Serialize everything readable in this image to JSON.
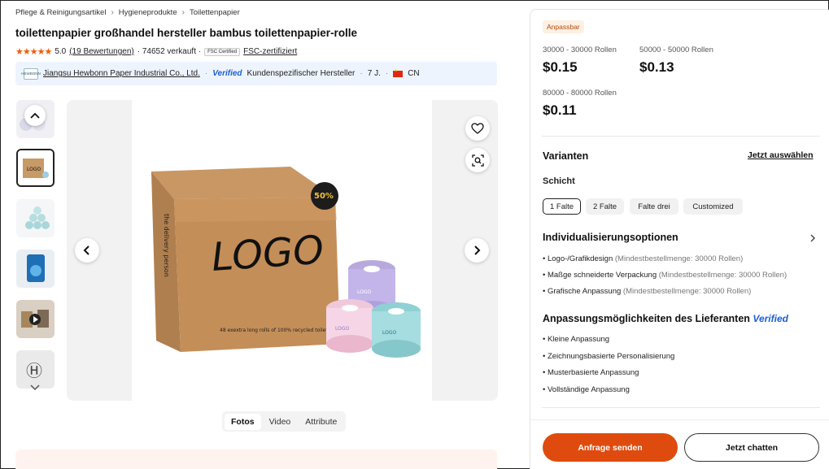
{
  "breadcrumb": [
    "Pflege & Reinigungsartikel",
    "Hygieneprodukte",
    "Toilettenpapier"
  ],
  "product": {
    "title": "toilettenpapier großhandel hersteller bambus toilettenpapier-rolle",
    "stars": "★★★★★",
    "rating": "5.0",
    "reviews": "(19 Bewertungen)",
    "sold": "· 74652 verkauft ·",
    "fsc_badge": "FSC Certified",
    "fsc_link": "FSC-zertifiziert"
  },
  "supplier": {
    "logo_text": "HEWBONN",
    "name": "Jiangsu Hewbonn Paper Industrial Co., Ltd.",
    "verified": "Verified",
    "type": "Kundenspezifischer Hersteller",
    "years": "7 J.",
    "country": "CN"
  },
  "gallery": {
    "box_logo": "LOGO",
    "box_side": "the delivery person",
    "box_badge": "50%",
    "box_caption": "48 exextra long rolls of 100% recycled toilet",
    "roll_logo": "LOGO",
    "tabs": [
      "Fotos",
      "Video",
      "Attribute"
    ]
  },
  "panel": {
    "badge": "Anpassbar",
    "tiers": [
      {
        "label": "30000 - 30000 Rollen",
        "price": "$0.15"
      },
      {
        "label": "50000 - 50000 Rollen",
        "price": "$0.13"
      },
      {
        "label": "80000 - 80000 Rollen",
        "price": "$0.11"
      }
    ],
    "variants_title": "Varianten",
    "variants_link": "Jetzt auswählen",
    "layer_title": "Schicht",
    "layers": [
      "1 Falte",
      "2 Falte",
      "Falte drei",
      "Customized"
    ],
    "custom_title": "Individualisierungsoptionen",
    "custom_options": [
      {
        "name": "Logo-/Grafikdesign",
        "note": "(Mindestbestellmenge: 30000 Rollen)"
      },
      {
        "name": "Maßge schneiderte Verpackung",
        "note": "(Mindestbestellmenge: 30000 Rollen)"
      },
      {
        "name": "Grafische Anpassung",
        "note": "(Mindestbestellmenge: 30000 Rollen)"
      }
    ],
    "supplier_custom_title": "Anpassungsmöglichkeiten des Lieferanten",
    "supplier_custom_verified": "Verified",
    "supplier_custom_items": [
      "Kleine Anpassung",
      "Zeichnungsbasierte Personalisierung",
      "Musterbasierte Anpassung",
      "Vollständige Anpassung"
    ],
    "btn_inquiry": "Anfrage senden",
    "btn_chat": "Jetzt chatten"
  },
  "colors": {
    "accent": "#df4b0e",
    "verified": "#1a5fd6",
    "stars": "#f25c05"
  }
}
